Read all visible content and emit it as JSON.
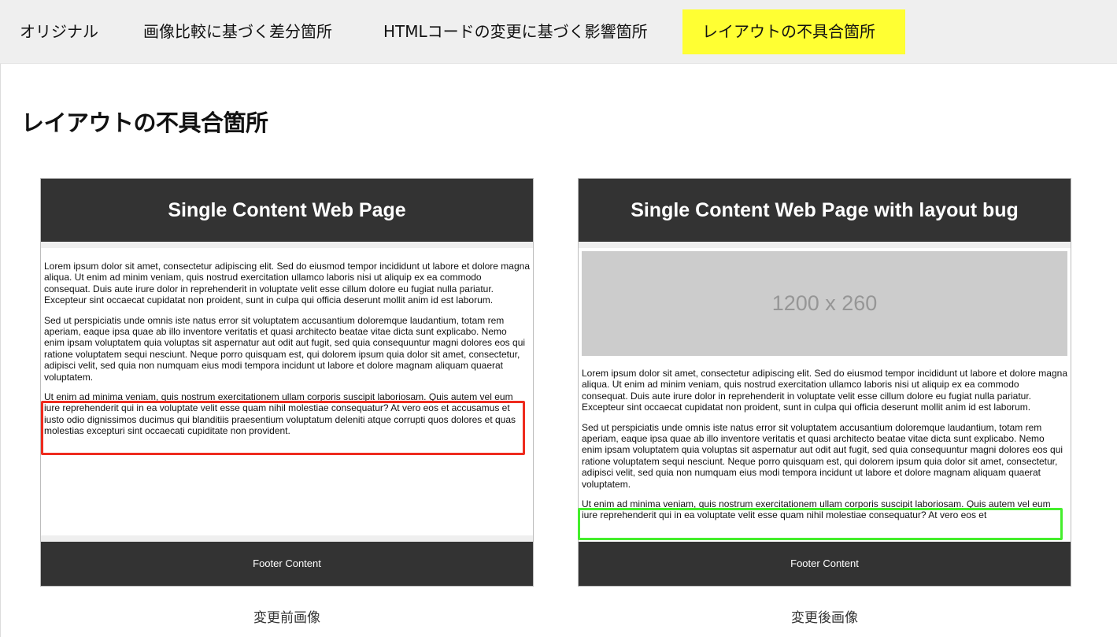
{
  "nav": {
    "tabs": [
      {
        "label": "オリジナル",
        "active": false
      },
      {
        "label": "画像比較に基づく差分箇所",
        "active": false
      },
      {
        "label": "HTMLコードの変更に基づく影響箇所",
        "active": false
      },
      {
        "label": "レイアウトの不具合箇所",
        "active": true
      }
    ],
    "active_color": "#ffff33"
  },
  "page_title": "レイアウトの不具合箇所",
  "before": {
    "header": "Single Content Web Page",
    "paragraphs": [
      "Lorem ipsum dolor sit amet, consectetur adipiscing elit. Sed do eiusmod tempor incididunt ut labore et dolore magna aliqua. Ut enim ad minim veniam, quis nostrud exercitation ullamco laboris nisi ut aliquip ex ea commodo consequat. Duis aute irure dolor in reprehenderit in voluptate velit esse cillum dolore eu fugiat nulla pariatur. Excepteur sint occaecat cupidatat non proident, sunt in culpa qui officia deserunt mollit anim id est laborum.",
      "Sed ut perspiciatis unde omnis iste natus error sit voluptatem accusantium doloremque laudantium, totam rem aperiam, eaque ipsa quae ab illo inventore veritatis et quasi architecto beatae vitae dicta sunt explicabo. Nemo enim ipsam voluptatem quia voluptas sit aspernatur aut odit aut fugit, sed quia consequuntur magni dolores eos qui ratione voluptatem sequi nesciunt. Neque porro quisquam est, qui dolorem ipsum quia dolor sit amet, consectetur, adipisci velit, sed quia non numquam eius modi tempora incidunt ut labore et dolore magnam aliquam quaerat voluptatem.",
      "Ut enim ad minima veniam, quis nostrum exercitationem ullam corporis suscipit laboriosam. Quis autem vel eum iure reprehenderit qui in ea voluptate velit esse quam nihil molestiae consequatur? At vero eos et accusamus et iusto odio dignissimos ducimus qui blanditiis praesentium voluptatum deleniti atque corrupti quos dolores et quas molestias excepturi sint occaecati cupiditate non provident."
    ],
    "footer": "Footer Content",
    "caption": "変更前画像",
    "highlight_color": "#ee2b1e"
  },
  "after": {
    "header": "Single Content Web Page with layout bug",
    "placeholder": "1200 x 260",
    "paragraphs": [
      "Lorem ipsum dolor sit amet, consectetur adipiscing elit. Sed do eiusmod tempor incididunt ut labore et dolore magna aliqua. Ut enim ad minim veniam, quis nostrud exercitation ullamco laboris nisi ut aliquip ex ea commodo consequat. Duis aute irure dolor in reprehenderit in voluptate velit esse cillum dolore eu fugiat nulla pariatur. Excepteur sint occaecat cupidatat non proident, sunt in culpa qui officia deserunt mollit anim id est laborum.",
      "Sed ut perspiciatis unde omnis iste natus error sit voluptatem accusantium doloremque laudantium, totam rem aperiam, eaque ipsa quae ab illo inventore veritatis et quasi architecto beatae vitae dicta sunt explicabo. Nemo enim ipsam voluptatem quia voluptas sit aspernatur aut odit aut fugit, sed quia consequuntur magni dolores eos qui ratione voluptatem sequi nesciunt. Neque porro quisquam est, qui dolorem ipsum quia dolor sit amet, consectetur, adipisci velit, sed quia non numquam eius modi tempora incidunt ut labore et dolore magnam aliquam quaerat voluptatem.",
      "Ut enim ad minima veniam, quis nostrum exercitationem ullam corporis suscipit laboriosam. Quis autem vel eum iure reprehenderit qui in ea voluptate velit esse quam nihil molestiae consequatur? At vero eos et"
    ],
    "footer": "Footer Content",
    "caption": "変更後画像",
    "highlight_color": "#44ee2c"
  }
}
